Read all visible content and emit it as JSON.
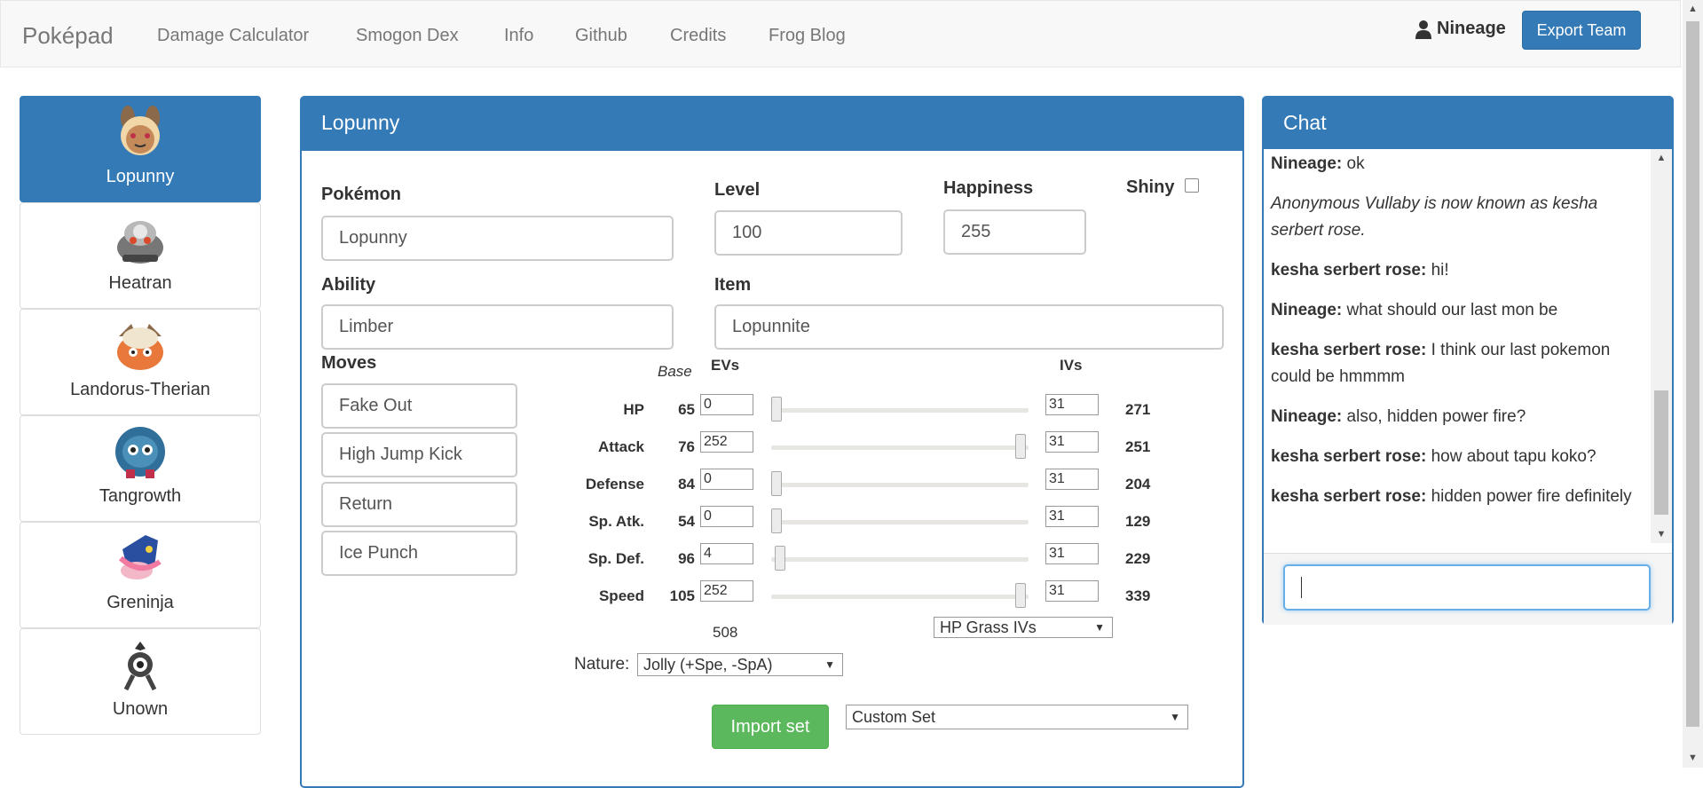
{
  "navbar": {
    "brand": "Poképad",
    "links": [
      "Damage Calculator",
      "Smogon Dex",
      "Info",
      "Github",
      "Credits",
      "Frog Blog"
    ],
    "user": "Nineage",
    "export_label": "Export Team"
  },
  "team": [
    {
      "name": "Lopunny",
      "active": true
    },
    {
      "name": "Heatran"
    },
    {
      "name": "Landorus-Therian"
    },
    {
      "name": "Tangrowth"
    },
    {
      "name": "Greninja"
    },
    {
      "name": "Unown"
    }
  ],
  "main": {
    "title": "Lopunny",
    "pokemon_label": "Pokémon",
    "pokemon_value": "Lopunny",
    "level_label": "Level",
    "level_value": "100",
    "happiness_label": "Happiness",
    "happiness_value": "255",
    "shiny_label": "Shiny",
    "ability_label": "Ability",
    "ability_value": "Limber",
    "item_label": "Item",
    "item_value": "Lopunnite",
    "moves_label": "Moves",
    "moves": [
      "Fake Out",
      "High Jump Kick",
      "Return",
      "Ice Punch"
    ],
    "base_label": "Base",
    "evs_label": "EVs",
    "ivs_label": "IVs",
    "stats": [
      {
        "name": "HP",
        "base": "65",
        "ev": "0",
        "iv": "31",
        "total": "271",
        "ev_fraction": 0
      },
      {
        "name": "Attack",
        "base": "76",
        "ev": "252",
        "iv": "31",
        "total": "251",
        "ev_fraction": 0.988
      },
      {
        "name": "Defense",
        "base": "84",
        "ev": "0",
        "iv": "31",
        "total": "204",
        "ev_fraction": 0
      },
      {
        "name": "Sp. Atk.",
        "base": "54",
        "ev": "0",
        "iv": "31",
        "total": "129",
        "ev_fraction": 0
      },
      {
        "name": "Sp. Def.",
        "base": "96",
        "ev": "4",
        "iv": "31",
        "total": "229",
        "ev_fraction": 0.016
      },
      {
        "name": "Speed",
        "base": "105",
        "ev": "252",
        "iv": "31",
        "total": "339",
        "ev_fraction": 0.988
      }
    ],
    "ev_total": "508",
    "hp_type": "HP Grass IVs",
    "nature_label": "Nature:",
    "nature_value": "Jolly (+Spe, -SpA)",
    "import_label": "Import set",
    "set_value": "Custom Set"
  },
  "chat": {
    "title": "Chat",
    "input_value": "",
    "messages": [
      {
        "user": "Nineage:",
        "text": " ok"
      },
      {
        "system": "Anonymous Vullaby is now known as kesha serbert rose."
      },
      {
        "user": "kesha serbert rose:",
        "text": " hi!"
      },
      {
        "user": "Nineage:",
        "text": " what should our last mon be"
      },
      {
        "user": "kesha serbert rose:",
        "text": " I think our last pokemon could be hmmmm"
      },
      {
        "user": "Nineage:",
        "text": " also, hidden power fire?"
      },
      {
        "user": "kesha serbert rose:",
        "text": " how about tapu koko?"
      },
      {
        "user": "kesha serbert rose:",
        "text": " hidden power fire definitely"
      }
    ]
  },
  "colors": {
    "primary": "#337ab7",
    "success": "#5cb85c"
  }
}
